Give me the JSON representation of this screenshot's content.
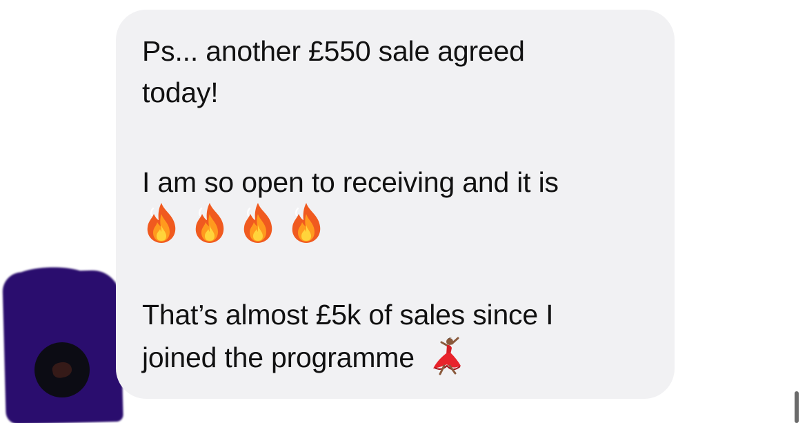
{
  "message": {
    "line1": "Ps... another £550 sale agreed",
    "line2": "today!",
    "line3": "I am so open to receiving and it is",
    "fire_count": 4,
    "line4": "That’s almost £5k of sales since I",
    "line5": "joined the programme"
  },
  "icons": {
    "fire": "fire-icon",
    "dancer": "dancer-icon",
    "avatar": "avatar"
  },
  "colors": {
    "bubble": "#f1f1f3",
    "text": "#111111",
    "redaction": "#2a0d6e",
    "avatar": "#0c0c14"
  }
}
